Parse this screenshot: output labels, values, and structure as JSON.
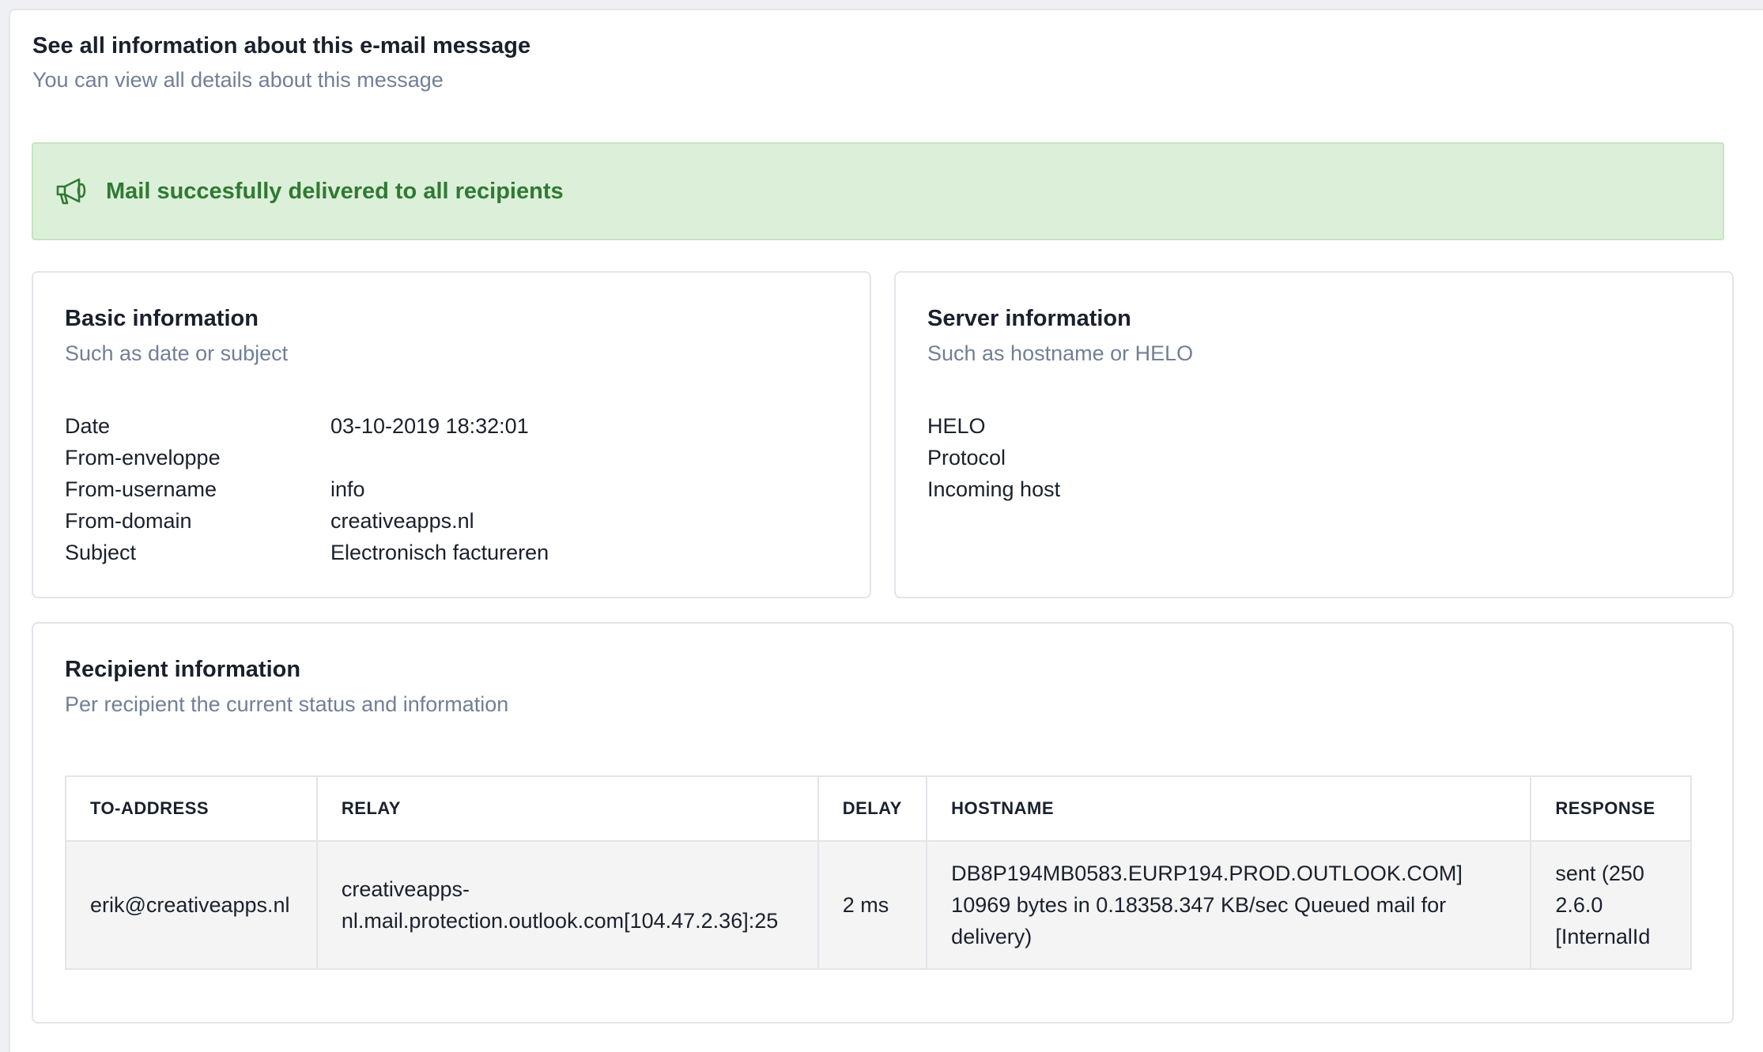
{
  "header": {
    "title": "See all information about this e-mail message",
    "subtitle": "You can view all details about this message"
  },
  "alert": {
    "icon": "megaphone-icon",
    "text": "Mail succesfully delivered to all recipients",
    "color": "#2f7a32",
    "background": "#dcefd9"
  },
  "basic": {
    "title": "Basic information",
    "subtitle": "Such as date or subject",
    "rows": [
      {
        "key": "Date",
        "value": "03-10-2019 18:32:01"
      },
      {
        "key": "From-enveloppe",
        "value": ""
      },
      {
        "key": "From-username",
        "value": "info"
      },
      {
        "key": "From-domain",
        "value": "creativeapps.nl"
      },
      {
        "key": "Subject",
        "value": "Electronisch factureren"
      }
    ]
  },
  "server": {
    "title": "Server information",
    "subtitle": "Such as hostname or HELO",
    "rows": [
      {
        "key": "HELO",
        "value": ""
      },
      {
        "key": "Protocol",
        "value": ""
      },
      {
        "key": "Incoming host",
        "value": ""
      }
    ]
  },
  "recipient": {
    "title": "Recipient information",
    "subtitle": "Per recipient the current status and information",
    "columns": [
      "TO-ADDRESS",
      "RELAY",
      "DELAY",
      "HOSTNAME",
      "RESPONSE"
    ],
    "rows": [
      {
        "to_address": "erik@creativeapps.nl",
        "relay": "creativeapps-nl.mail.protection.outlook.com[104.47.2.36]:25",
        "delay": "2 ms",
        "hostname": "DB8P194MB0583.EURP194.PROD.OUTLOOK.COM] 10969 bytes in 0.18358.347 KB/sec Queued mail for delivery)",
        "response": "sent (250 2.6.0 [InternalId"
      }
    ]
  }
}
